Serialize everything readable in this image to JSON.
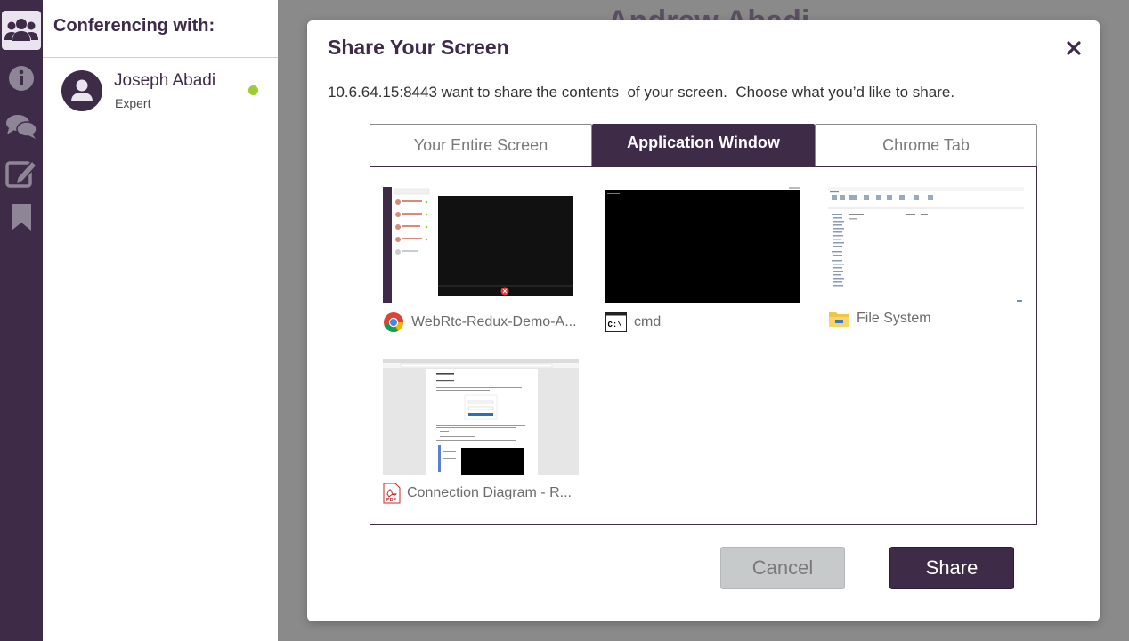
{
  "sidebar": {
    "title": "Conferencing with:",
    "participants": [
      {
        "name": "Joseph Abadi",
        "role": "Expert",
        "status_color": "#9acd32"
      }
    ]
  },
  "rail": {
    "icons": [
      "users-icon",
      "info-icon",
      "chat-icon",
      "edit-icon",
      "bookmark-icon"
    ]
  },
  "background": {
    "heading": "Andrew Abadi"
  },
  "dialog": {
    "title": "Share Your Screen",
    "message": "10.6.64.15:8443 want to share the contents  of your screen.  Choose what you’d like to share.",
    "tabs": [
      {
        "label": "Your Entire Screen",
        "selected": false
      },
      {
        "label": "Application Window",
        "selected": true
      },
      {
        "label": "Chrome Tab",
        "selected": false
      }
    ],
    "windows": [
      {
        "label": "WebRtc-Redux-Demo-A...",
        "icon": "chrome-icon"
      },
      {
        "label": "cmd",
        "icon": "cmd-icon",
        "icon_text": "C:\\"
      },
      {
        "label": "File System",
        "icon": "folder-icon"
      },
      {
        "label": "Connection Diagram - R...",
        "icon": "pdf-icon",
        "icon_text": "PDF"
      }
    ],
    "cancel_label": "Cancel",
    "share_label": "Share"
  },
  "colors": {
    "brand": "#3d2b48",
    "online": "#9acd32",
    "overlay": "#8a8a8a"
  }
}
